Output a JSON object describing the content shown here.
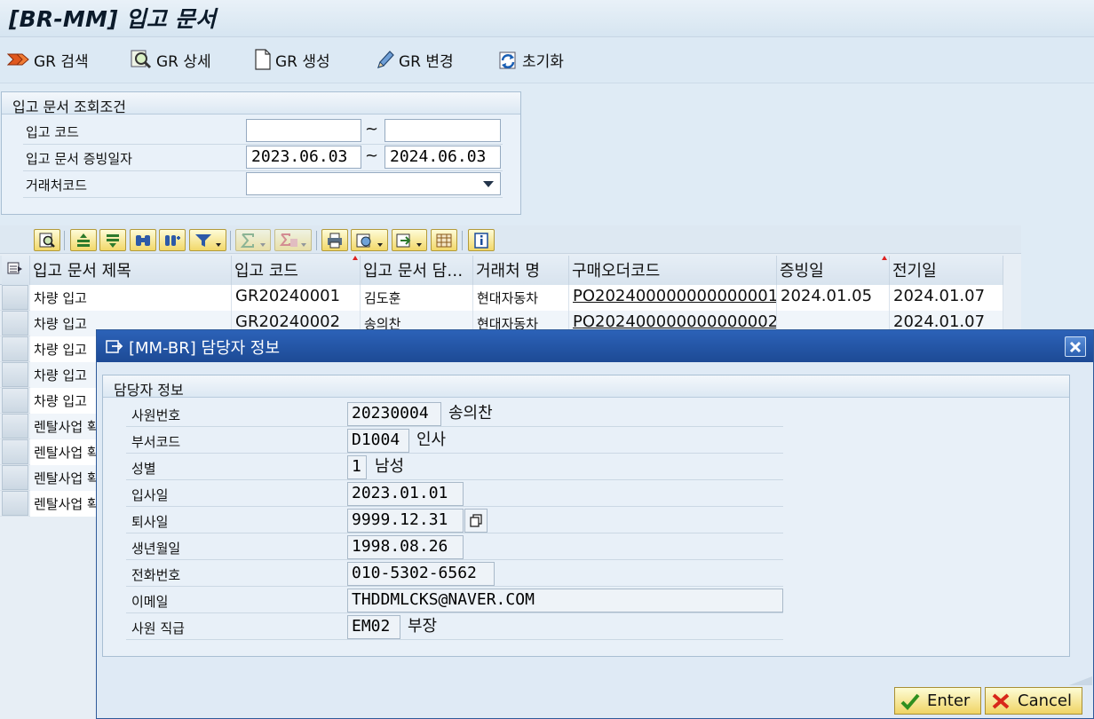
{
  "window": {
    "title": "[BR-MM] 입고 문서"
  },
  "toolbar": {
    "gr_search": "GR 검색",
    "gr_detail": "GR 상세",
    "gr_create": "GR 생성",
    "gr_change": "GR 변경",
    "reset": "초기화"
  },
  "search": {
    "group_title": "입고 문서 조회조건",
    "fields": [
      {
        "label": "입고 코드",
        "from": "",
        "to": ""
      },
      {
        "label": "입고 문서 증빙일자",
        "from": "2023.06.03",
        "to": "2024.06.03"
      },
      {
        "label": "거래처코드",
        "value": ""
      }
    ],
    "tilde": "~"
  },
  "grid": {
    "columns": [
      "입고 문서 제목",
      "입고 코드",
      "입고 문서 담…",
      "거래처 명",
      "구매오더코드",
      "증빙일",
      "전기일"
    ],
    "rows": [
      {
        "title": "차량 입고",
        "code": "GR20240001",
        "manager": "김도훈",
        "vendor": "현대자동차",
        "po": "PO202400000000000001",
        "doc_date": "2024.01.05",
        "post_date": "2024.01.07"
      },
      {
        "title": "차량 입고",
        "code": "GR20240002",
        "manager": "송의찬",
        "vendor": "현대자동차",
        "po": "PO202400000000000002",
        "doc_date": "",
        "post_date": "2024.01.07"
      },
      {
        "title": "차량 입고"
      },
      {
        "title": "차량 입고"
      },
      {
        "title": "차량 입고"
      },
      {
        "title": "렌탈사업 확"
      },
      {
        "title": "렌탈사업 확"
      },
      {
        "title": "렌탈사업 확"
      },
      {
        "title": "렌탈사업 확"
      }
    ]
  },
  "dialog": {
    "title": "[MM-BR] 담당자 정보",
    "group_title": "담당자 정보",
    "fields": [
      {
        "label": "사원번호",
        "value": "20230004",
        "text": "송의찬"
      },
      {
        "label": "부서코드",
        "value": "D1004",
        "text": "인사"
      },
      {
        "label": "성별",
        "value": "1",
        "text": "남성"
      },
      {
        "label": "입사일",
        "value": "2023.01.01"
      },
      {
        "label": "퇴사일",
        "value": "9999.12.31"
      },
      {
        "label": "생년월일",
        "value": "1998.08.26"
      },
      {
        "label": "전화번호",
        "value": "010-5302-6562"
      },
      {
        "label": "이메일",
        "value": "THDDMLCKS@NAVER.COM"
      },
      {
        "label": "사원 직급",
        "value": "EM02",
        "text": "부장"
      }
    ],
    "enter_label": "Enter",
    "cancel_label": "Cancel"
  }
}
